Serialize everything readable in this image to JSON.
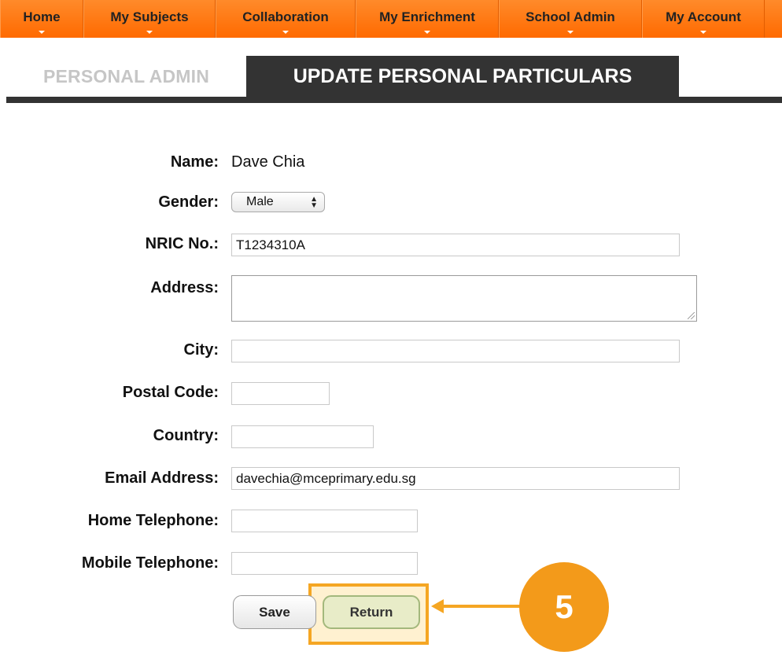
{
  "nav": {
    "items": [
      {
        "label": "Home"
      },
      {
        "label": "My Subjects"
      },
      {
        "label": "Collaboration"
      },
      {
        "label": "My Enrichment"
      },
      {
        "label": "School Admin"
      },
      {
        "label": "My Account"
      }
    ]
  },
  "subtabs": {
    "personal_admin": "PERSONAL ADMIN",
    "update_particulars": "UPDATE PERSONAL PARTICULARS"
  },
  "form": {
    "name": {
      "label": "Name:",
      "value": "Dave Chia"
    },
    "gender": {
      "label": "Gender:",
      "selected": "Male"
    },
    "nric": {
      "label": "NRIC No.:",
      "value": "T1234310A"
    },
    "address": {
      "label": "Address:",
      "value": ""
    },
    "city": {
      "label": "City:",
      "value": ""
    },
    "postal_code": {
      "label": "Postal Code:",
      "value": ""
    },
    "country": {
      "label": "Country:",
      "value": ""
    },
    "email": {
      "label": "Email Address:",
      "value": "davechia@mceprimary.edu.sg"
    },
    "home_telephone": {
      "label": "Home Telephone:",
      "value": ""
    },
    "mobile_telephone": {
      "label": "Mobile Telephone:",
      "value": ""
    }
  },
  "buttons": {
    "save": "Save",
    "return": "Return"
  },
  "annotation": {
    "step_number": "5",
    "color": "#f39a1a"
  },
  "colors": {
    "nav_orange": "#ff6a00",
    "tab_dark": "#333333",
    "return_button": "#e8ecc8"
  }
}
